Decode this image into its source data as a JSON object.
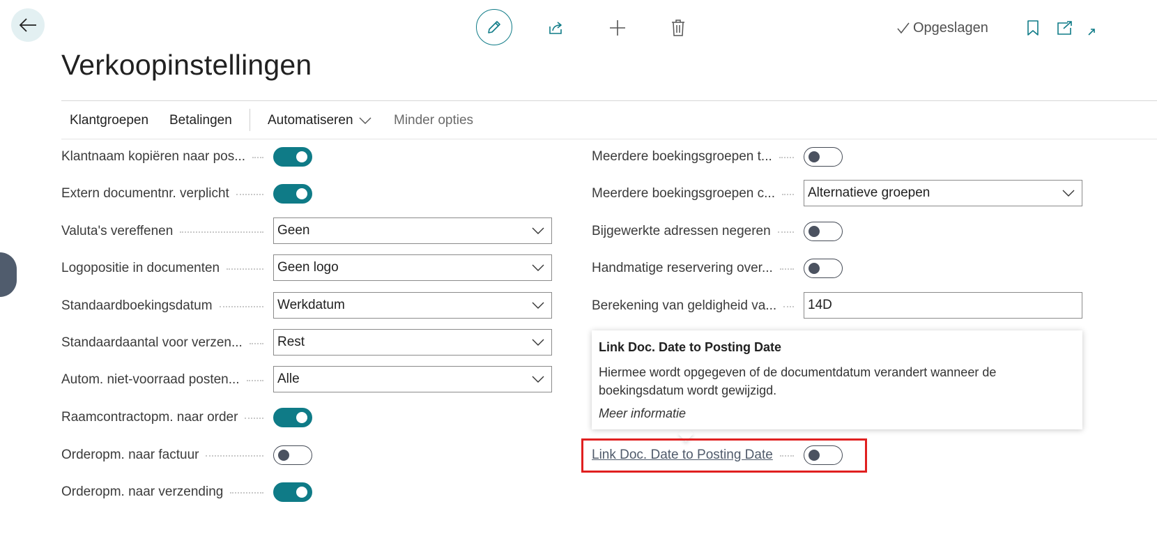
{
  "toolbar": {
    "saved_label": "Opgeslagen"
  },
  "page": {
    "title": "Verkoopinstellingen"
  },
  "actions": {
    "klantgroepen": "Klantgroepen",
    "betalingen": "Betalingen",
    "automatiseren": "Automatiseren",
    "minder_opties": "Minder opties"
  },
  "left_fields": [
    {
      "label": "Klantnaam kopiëren naar pos...",
      "type": "toggle",
      "value": true
    },
    {
      "label": "Extern documentnr. verplicht",
      "type": "toggle",
      "value": true
    },
    {
      "label": "Valuta's vereffenen",
      "type": "select",
      "value": "Geen"
    },
    {
      "label": "Logopositie in documenten",
      "type": "select",
      "value": "Geen logo"
    },
    {
      "label": "Standaardboekingsdatum",
      "type": "select",
      "value": "Werkdatum"
    },
    {
      "label": "Standaardaantal voor verzen...",
      "type": "select",
      "value": "Rest"
    },
    {
      "label": "Autom. niet-voorraad posten...",
      "type": "select",
      "value": "Alle"
    },
    {
      "label": "Raamcontractopm. naar order",
      "type": "toggle",
      "value": true
    },
    {
      "label": "Orderopm. naar factuur",
      "type": "toggle",
      "value": false
    },
    {
      "label": "Orderopm. naar verzending",
      "type": "toggle",
      "value": true
    }
  ],
  "right_fields": [
    {
      "label": "Meerdere boekingsgroepen t...",
      "type": "toggle",
      "value": false
    },
    {
      "label": "Meerdere boekingsgroepen c...",
      "type": "select",
      "value": "Alternatieve groepen"
    },
    {
      "label": "Bijgewerkte adressen negeren",
      "type": "toggle",
      "value": false
    },
    {
      "label": "Handmatige reservering over...",
      "type": "toggle",
      "value": false
    },
    {
      "label": "Berekening van geldigheid va...",
      "type": "text",
      "value": "14D"
    },
    {
      "label": "Link Doc. Date to Posting Date",
      "type": "toggle",
      "value": false
    }
  ],
  "tooltip": {
    "title": "Link Doc. Date to Posting Date",
    "body": "Hiermee wordt opgegeven of de documentdatum verandert wanneer de boekingsdatum wordt gewijzigd.",
    "link": "Meer informatie"
  },
  "colors": {
    "accent": "#0f7b87",
    "highlight": "#e02020"
  }
}
